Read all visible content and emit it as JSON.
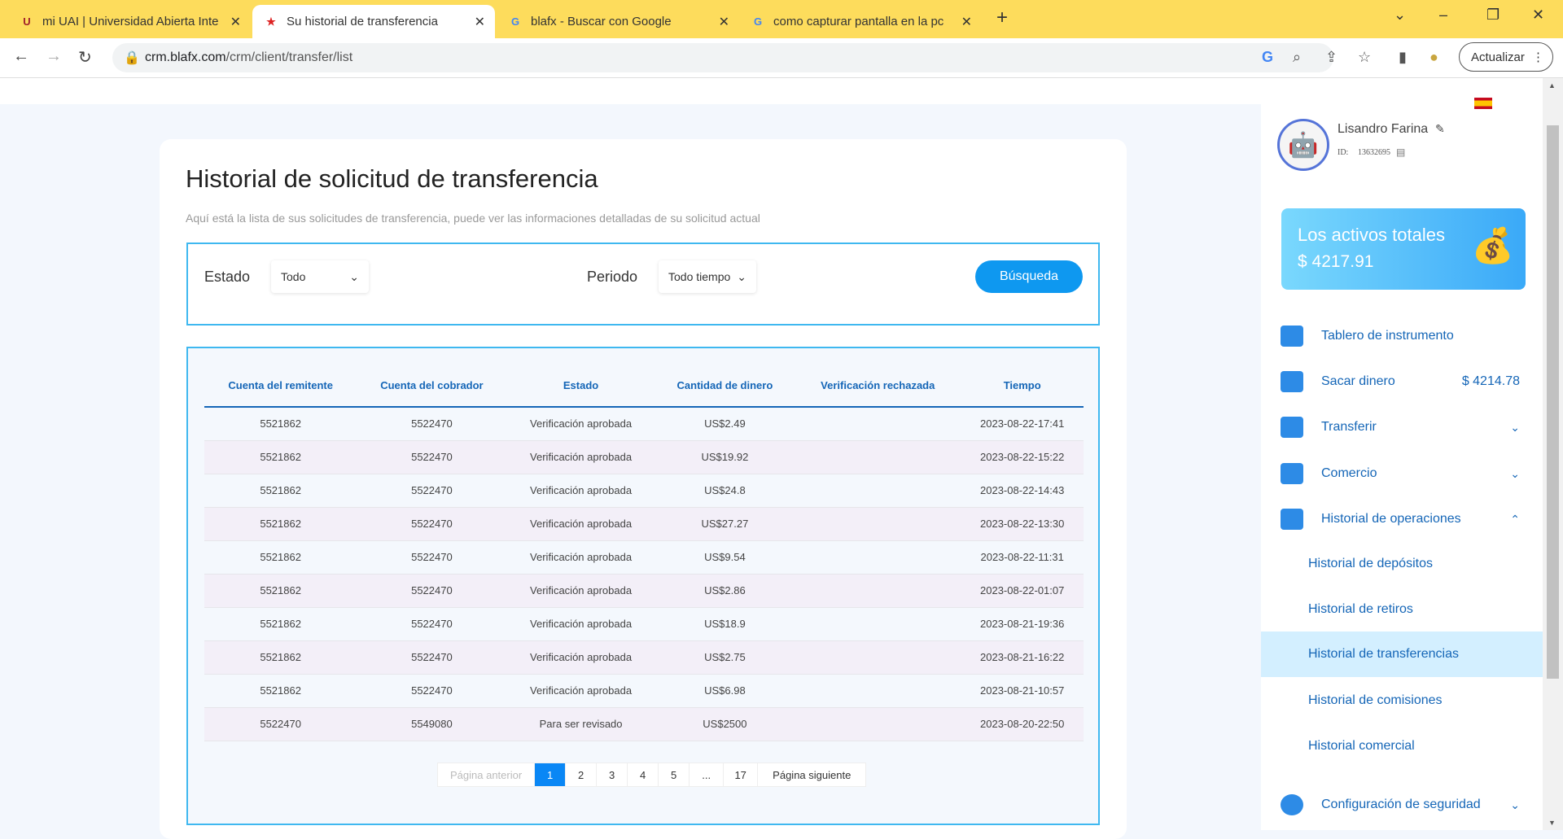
{
  "browser": {
    "tabs": [
      {
        "title": "mi UAI | Universidad Abierta Inte",
        "icon": "uai-icon"
      },
      {
        "title": "Su historial de transferencia",
        "icon": "blafx-icon"
      },
      {
        "title": "blafx - Buscar con Google",
        "icon": "google-icon"
      },
      {
        "title": "como capturar pantalla en la pc",
        "icon": "google-icon"
      }
    ],
    "url_host": "crm.blafx.com",
    "url_path": "/crm/client/transfer/list",
    "update_label": "Actualizar"
  },
  "page": {
    "title": "Historial de solicitud de transferencia",
    "subtitle": "Aquí está la lista de sus solicitudes de transferencia, puede ver las informaciones detalladas de su solicitud actual"
  },
  "filter": {
    "estado_label": "Estado",
    "estado_value": "Todo",
    "periodo_label": "Periodo",
    "periodo_value": "Todo tiempo",
    "search_label": "Búsqueda"
  },
  "table": {
    "columns": [
      "Cuenta del remitente",
      "Cuenta del cobrador",
      "Estado",
      "Cantidad de dinero",
      "Verificación rechazada",
      "Tiempo"
    ],
    "rows": [
      [
        "5521862",
        "5522470",
        "Verificación aprobada",
        "US$2.49",
        "",
        "2023-08-22-17:41"
      ],
      [
        "5521862",
        "5522470",
        "Verificación aprobada",
        "US$19.92",
        "",
        "2023-08-22-15:22"
      ],
      [
        "5521862",
        "5522470",
        "Verificación aprobada",
        "US$24.8",
        "",
        "2023-08-22-14:43"
      ],
      [
        "5521862",
        "5522470",
        "Verificación aprobada",
        "US$27.27",
        "",
        "2023-08-22-13:30"
      ],
      [
        "5521862",
        "5522470",
        "Verificación aprobada",
        "US$9.54",
        "",
        "2023-08-22-11:31"
      ],
      [
        "5521862",
        "5522470",
        "Verificación aprobada",
        "US$2.86",
        "",
        "2023-08-22-01:07"
      ],
      [
        "5521862",
        "5522470",
        "Verificación aprobada",
        "US$18.9",
        "",
        "2023-08-21-19:36"
      ],
      [
        "5521862",
        "5522470",
        "Verificación aprobada",
        "US$2.75",
        "",
        "2023-08-21-16:22"
      ],
      [
        "5521862",
        "5522470",
        "Verificación aprobada",
        "US$6.98",
        "",
        "2023-08-21-10:57"
      ],
      [
        "5522470",
        "5549080",
        "Para ser revisado",
        "US$2500",
        "",
        "2023-08-20-22:50"
      ]
    ]
  },
  "pagination": {
    "prev": "Página anterior",
    "pages": [
      "1",
      "2",
      "3",
      "4",
      "5",
      "...",
      "17"
    ],
    "current": "1",
    "next": "Página siguiente"
  },
  "user": {
    "name": "Lisandro Farina",
    "id_label": "ID:",
    "id": "13632695"
  },
  "assets": {
    "label": "Los activos totales",
    "value": "$ 4217.91"
  },
  "menu": [
    {
      "label": "Tablero de instrumento"
    },
    {
      "label": "Sacar dinero",
      "value": "$ 4214.78"
    },
    {
      "label": "Transferir"
    },
    {
      "label": "Comercio"
    },
    {
      "label": "Historial de operaciones"
    },
    {
      "label": "Historial de depósitos"
    },
    {
      "label": "Historial de retiros"
    },
    {
      "label": "Historial de transferencias"
    },
    {
      "label": "Historial de comisiones"
    },
    {
      "label": "Historial comercial"
    },
    {
      "label": "Configuración de seguridad"
    }
  ],
  "colors": {
    "accent": "#0e98f0",
    "link": "#1566b7",
    "tabbar": "#fddc5c"
  }
}
